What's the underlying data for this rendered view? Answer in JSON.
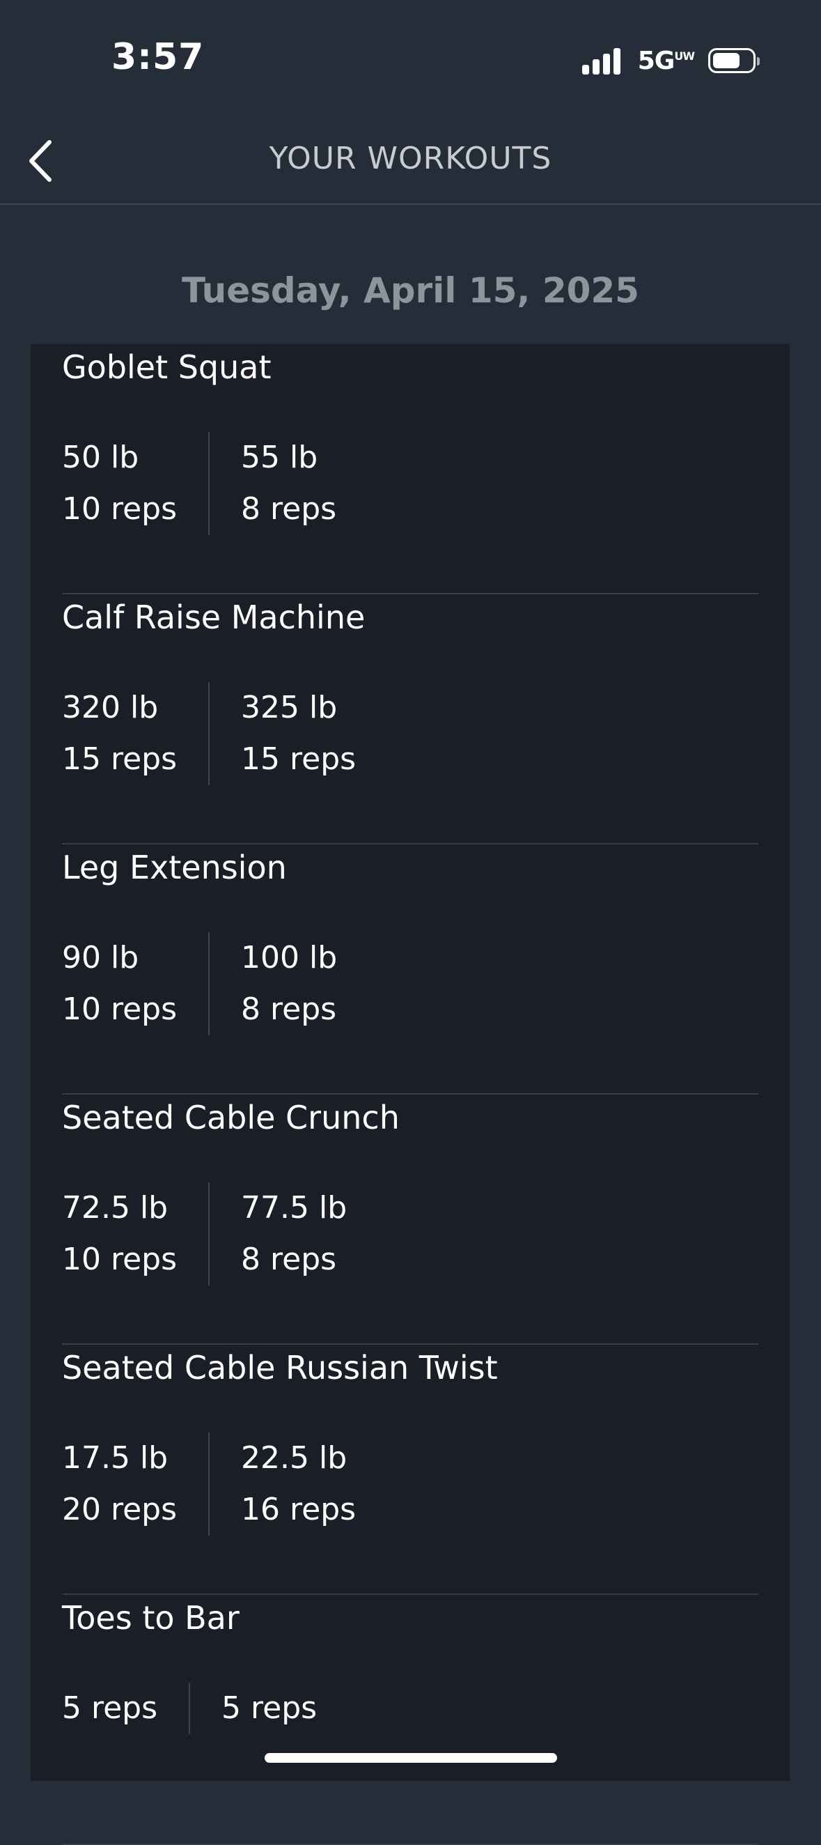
{
  "status_bar": {
    "time": "3:57",
    "network": "5G",
    "network_sup": "UW",
    "signal_icon": "signal-bars-icon",
    "battery_icon": "battery-icon"
  },
  "header": {
    "title": "YOUR WORKOUTS",
    "back_icon": "chevron-left-icon"
  },
  "date": "Tuesday, April 15, 2025",
  "exercises": [
    {
      "name": "Goblet Squat",
      "sets": [
        {
          "weight": "50 lb",
          "reps": "10 reps"
        },
        {
          "weight": "55 lb",
          "reps": "8 reps"
        }
      ]
    },
    {
      "name": "Calf Raise Machine",
      "sets": [
        {
          "weight": "320 lb",
          "reps": "15 reps"
        },
        {
          "weight": "325 lb",
          "reps": "15 reps"
        }
      ]
    },
    {
      "name": "Leg Extension",
      "sets": [
        {
          "weight": "90 lb",
          "reps": "10 reps"
        },
        {
          "weight": "100 lb",
          "reps": "8 reps"
        }
      ]
    },
    {
      "name": "Seated Cable Crunch",
      "sets": [
        {
          "weight": "72.5 lb",
          "reps": "10 reps"
        },
        {
          "weight": "77.5 lb",
          "reps": "8 reps"
        }
      ]
    },
    {
      "name": "Seated Cable Russian Twist",
      "sets": [
        {
          "weight": "17.5 lb",
          "reps": "20 reps"
        },
        {
          "weight": "22.5 lb",
          "reps": "16 reps"
        }
      ]
    },
    {
      "name": "Toes to Bar",
      "sets": [
        {
          "reps": "5 reps"
        },
        {
          "reps": "5 reps"
        }
      ]
    }
  ],
  "colors": {
    "background": "#252d39",
    "card": "#1a1f27",
    "title": "#c8ccd2",
    "date": "#8e949c",
    "divider": "#363e4b"
  }
}
